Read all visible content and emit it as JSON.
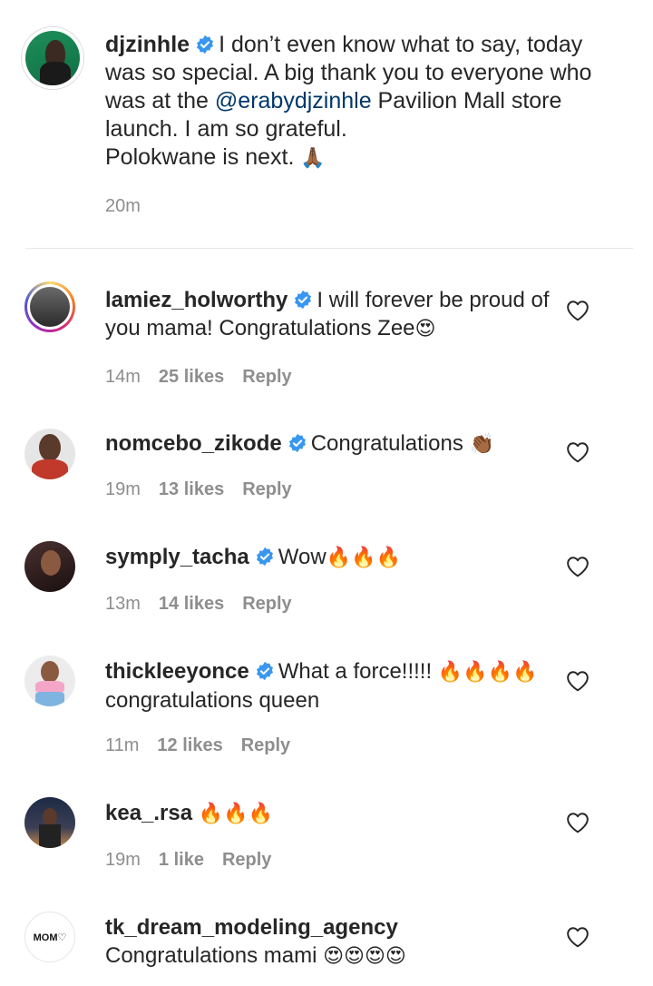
{
  "post": {
    "username": "djzinhle",
    "caption_part1": "I don’t even know what to say, today was so special. A big thank you to everyone who was at the ",
    "mention": "@erabydjzinhle",
    "caption_part2": " Pavilion Mall store launch. I am so grateful.",
    "caption_line2": "Polokwane is next. ",
    "caption_emoji": "🙏🏾",
    "time": "20m"
  },
  "comments": [
    {
      "username": "lamiez_holworthy",
      "verified": true,
      "text": "I will forever be proud of you mama! Congratulations Zee",
      "emoji": "😍",
      "time": "14m",
      "likes": "25 likes",
      "reply": "Reply"
    },
    {
      "username": "nomcebo_zikode",
      "verified": true,
      "text": "Congratulations ",
      "emoji": "👏🏾",
      "time": "19m",
      "likes": "13 likes",
      "reply": "Reply"
    },
    {
      "username": "symply_tacha",
      "verified": true,
      "text": "Wow",
      "emoji": "🔥🔥🔥",
      "time": "13m",
      "likes": "14 likes",
      "reply": "Reply"
    },
    {
      "username": "thickleeyonce",
      "verified": true,
      "text": "What a force!!!!! ",
      "emoji": "🔥🔥🔥🔥",
      "text2": "congratulations queen",
      "time": "11m",
      "likes": "12 likes",
      "reply": "Reply"
    },
    {
      "username": "kea_.rsa",
      "verified": false,
      "text": "",
      "emoji": "🔥🔥🔥",
      "time": "19m",
      "likes": "1 like",
      "reply": "Reply"
    },
    {
      "username": "tk_dream_modeling_agency",
      "verified": false,
      "text": "Congratulations mami ",
      "emoji": "😍😍😍😍"
    }
  ],
  "icons": {
    "verified": "verified-badge-icon",
    "heart": "heart-outline-icon"
  },
  "colors": {
    "verified": "#3897f0",
    "mention": "#00376b",
    "muted": "#8e8e8e"
  },
  "avatar_logo_text": "MOM♡"
}
